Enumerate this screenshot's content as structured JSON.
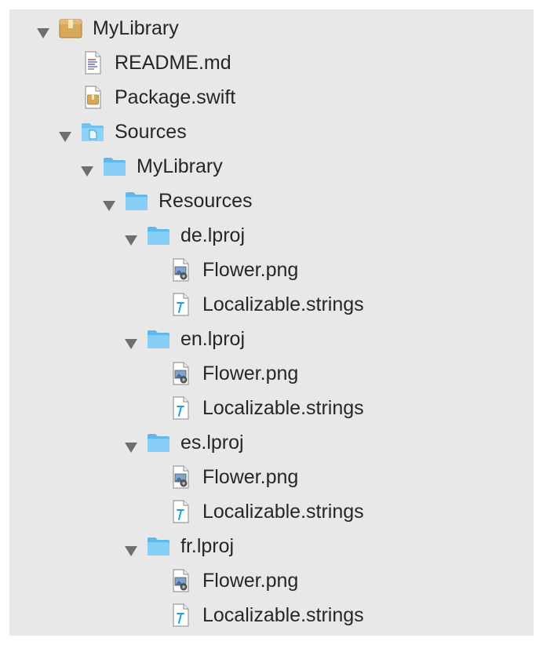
{
  "tree": [
    {
      "label": "MyLibrary",
      "icon": "package-icon",
      "depth": 0,
      "expanded": true
    },
    {
      "label": "README.md",
      "icon": "text-file-icon",
      "depth": 1
    },
    {
      "label": "Package.swift",
      "icon": "package-manifest-file-icon",
      "depth": 1
    },
    {
      "label": "Sources",
      "icon": "sources-folder-icon",
      "depth": 1,
      "expanded": true
    },
    {
      "label": "MyLibrary",
      "icon": "folder-icon",
      "depth": 2,
      "expanded": true
    },
    {
      "label": "Resources",
      "icon": "folder-icon",
      "depth": 3,
      "expanded": true
    },
    {
      "label": "de.lproj",
      "icon": "folder-icon",
      "depth": 4,
      "expanded": true
    },
    {
      "label": "Flower.png",
      "icon": "image-file-icon",
      "depth": 5
    },
    {
      "label": "Localizable.strings",
      "icon": "strings-file-icon",
      "depth": 5
    },
    {
      "label": "en.lproj",
      "icon": "folder-icon",
      "depth": 4,
      "expanded": true
    },
    {
      "label": "Flower.png",
      "icon": "image-file-icon",
      "depth": 5
    },
    {
      "label": "Localizable.strings",
      "icon": "strings-file-icon",
      "depth": 5
    },
    {
      "label": "es.lproj",
      "icon": "folder-icon",
      "depth": 4,
      "expanded": true
    },
    {
      "label": "Flower.png",
      "icon": "image-file-icon",
      "depth": 5
    },
    {
      "label": "Localizable.strings",
      "icon": "strings-file-icon",
      "depth": 5
    },
    {
      "label": "fr.lproj",
      "icon": "folder-icon",
      "depth": 4,
      "expanded": true
    },
    {
      "label": "Flower.png",
      "icon": "image-file-icon",
      "depth": 5
    },
    {
      "label": "Localizable.strings",
      "icon": "strings-file-icon",
      "depth": 5
    }
  ],
  "colors": {
    "background": "#e8e8e8",
    "text": "#262626",
    "disclosure": "#6e6e6e",
    "folder": "#6ec3f2",
    "package": "#d8a85a",
    "strings_glyph": "#1e9fe0"
  }
}
